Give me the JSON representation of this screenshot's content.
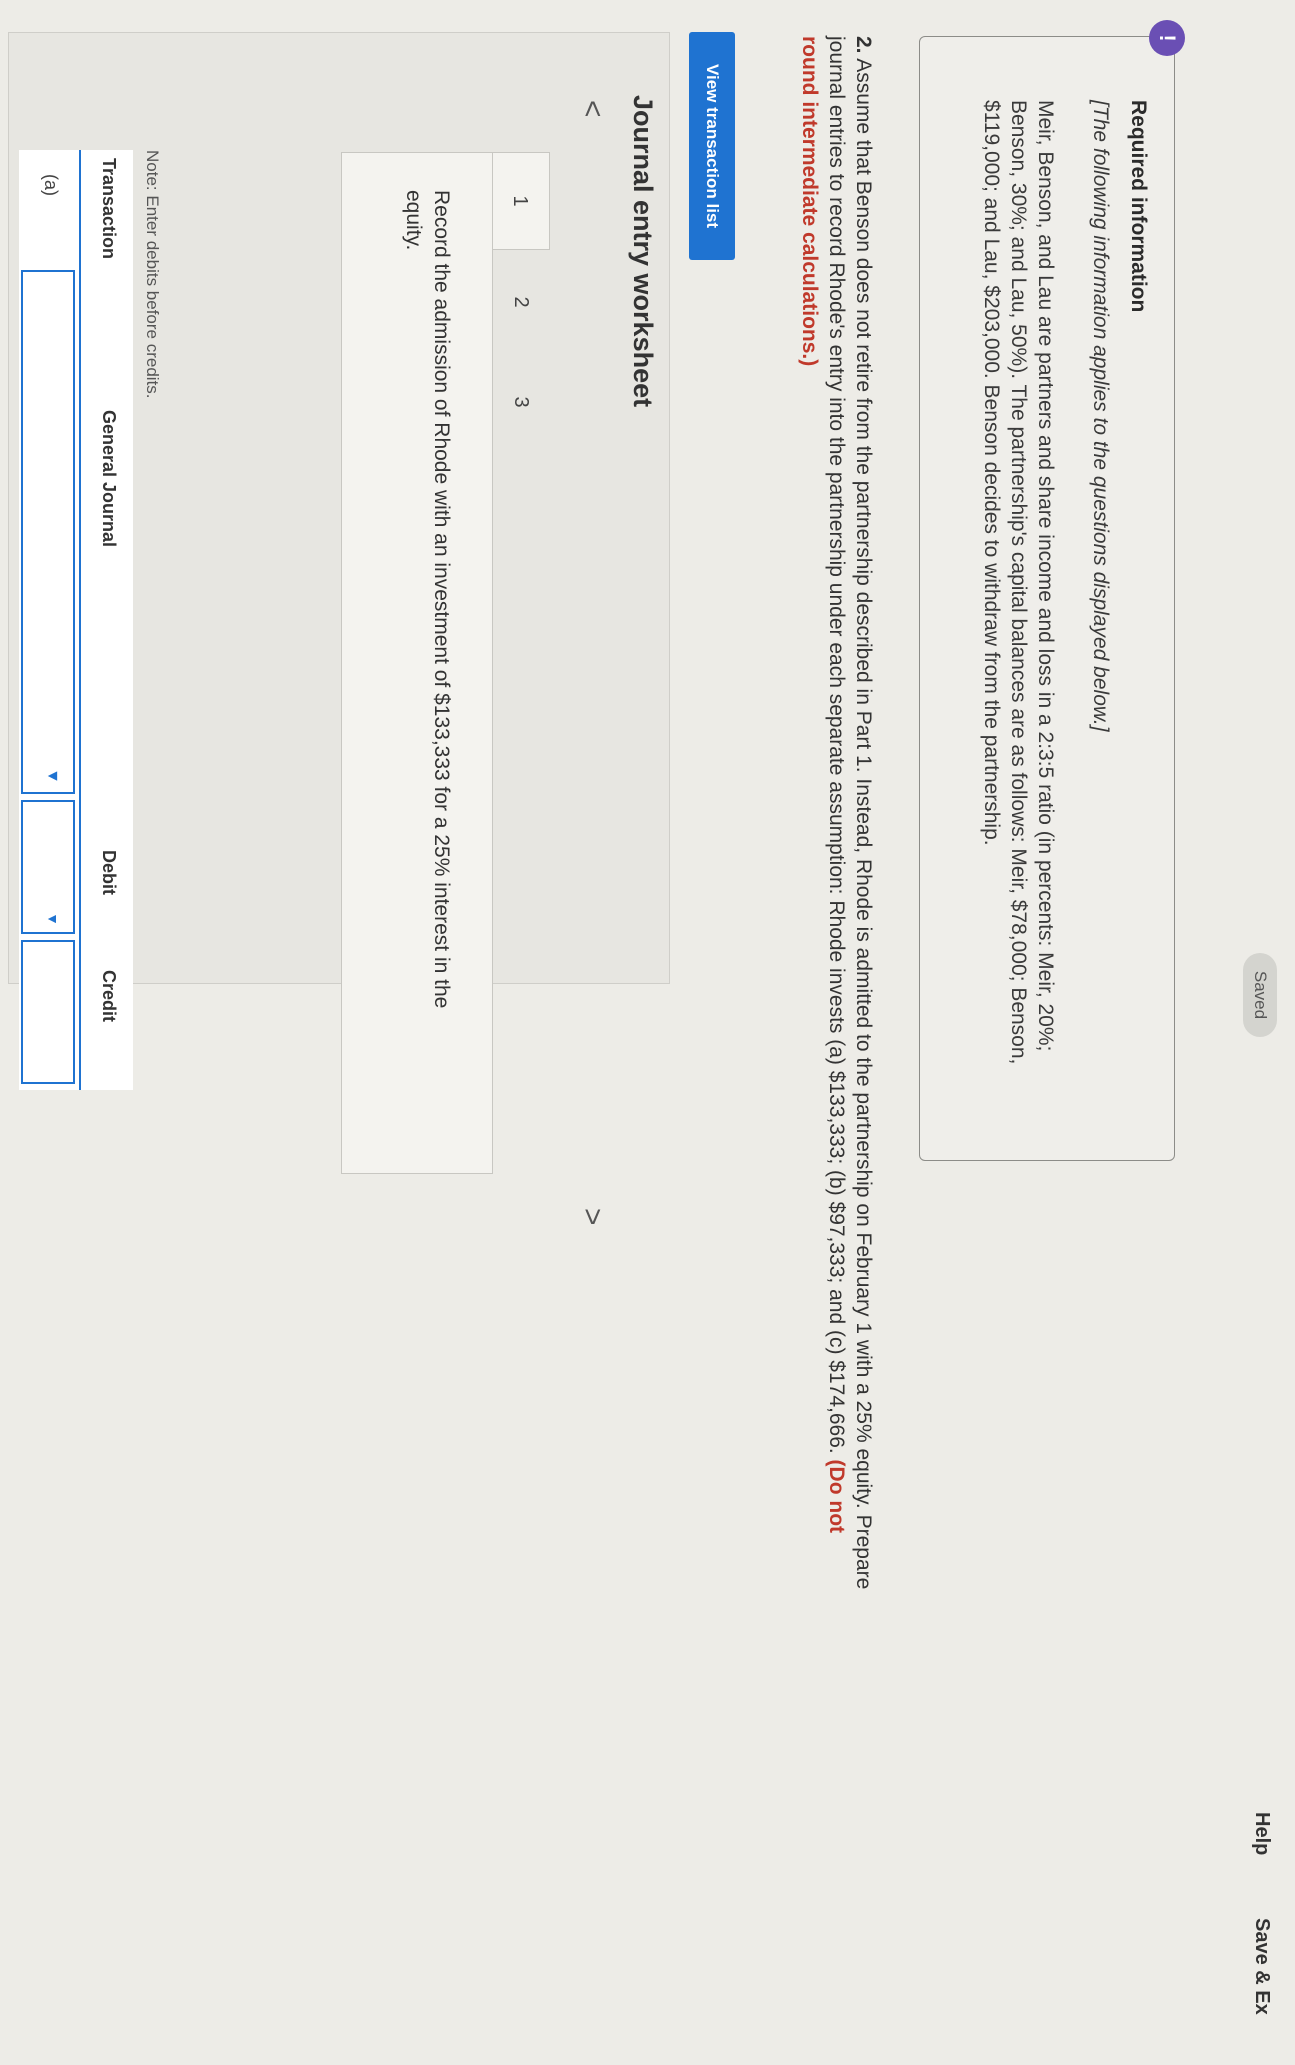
{
  "topbar": {
    "saved_label": "Saved",
    "help_label": "Help",
    "save_exit_label": "Save & Ex"
  },
  "required_info": {
    "badge": "!",
    "title": "Required information",
    "note": "[The following information applies to the questions displayed below.]",
    "body": "Meir, Benson, and Lau are partners and share income and loss in a 2:3:5 ratio (in percents: Meir, 20%; Benson, 30%; and Lau, 50%). The partnership's capital balances are as follows: Meir, $78,000; Benson, $119,000; and Lau, $203,000. Benson decides to withdraw from the partnership."
  },
  "question": {
    "number": "2.",
    "text": " Assume that Benson does not retire from the partnership described in Part 1. Instead, Rhode is admitted to the partnership on February 1 with a 25% equity. Prepare journal entries to record Rhode's entry into the partnership under each separate assumption: Rhode invests (a) $133,333; (b) $97,333; and (c) $174,666. ",
    "warning": "(Do not round intermediate calculations.)"
  },
  "view_transaction_list_label": "View transaction list",
  "worksheet": {
    "title": "Journal entry worksheet",
    "prev_icon_glyph": "<",
    "next_icon_glyph": ">",
    "tabs": [
      "1",
      "2",
      "3"
    ],
    "instruction": "Record the admission of Rhode with an investment of $133,333 for a 25% interest in the equity.",
    "note": "Note: Enter debits before credits.",
    "table": {
      "headers": [
        "Transaction",
        "General Journal",
        "Debit",
        "Credit"
      ],
      "rows": [
        {
          "transaction": "(a)",
          "general_journal": "",
          "debit": "",
          "credit": ""
        }
      ]
    }
  },
  "colors": {
    "accent_blue": "#1f73d1",
    "badge_purple": "#6a4fb4",
    "warning_red": "#c0392b"
  }
}
